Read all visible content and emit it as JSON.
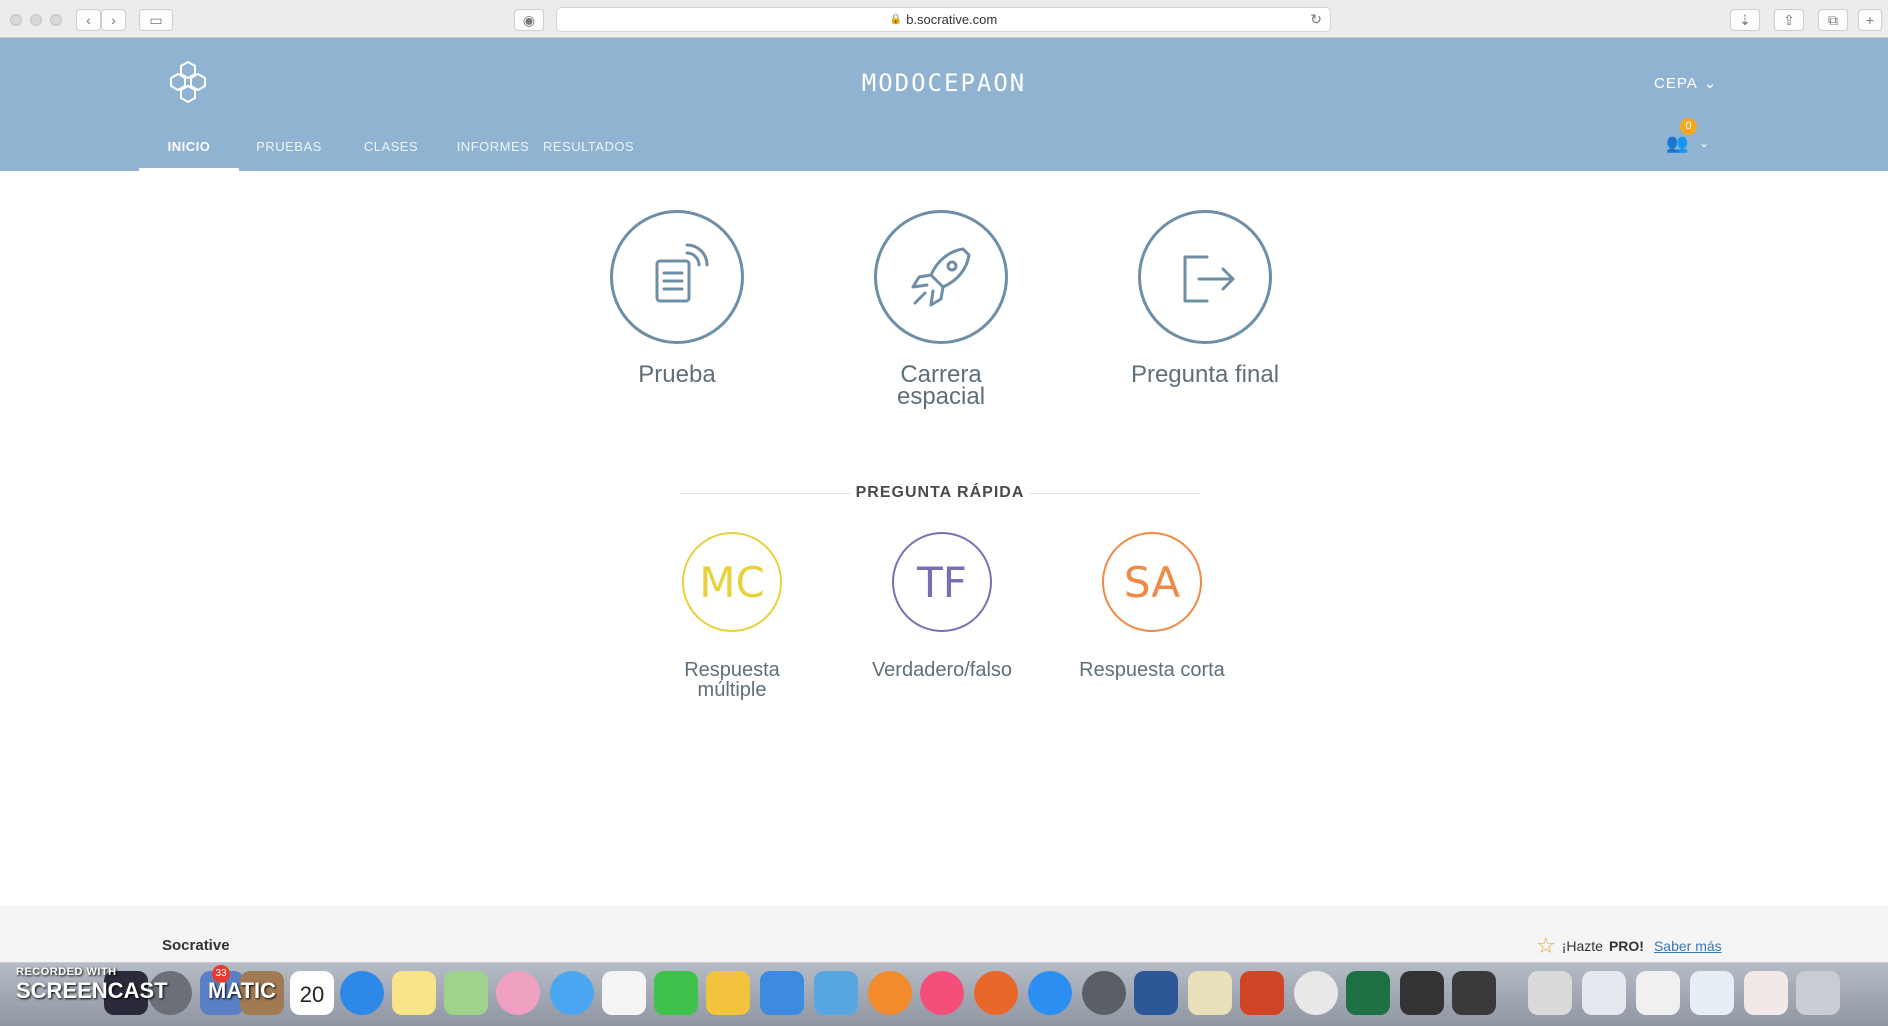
{
  "browser": {
    "url": "b.socrative.com"
  },
  "header": {
    "title": "MODOCEPAON",
    "user_label": "CEPA",
    "notification_count": "0",
    "nav": [
      "INICIO",
      "PRUEBAS",
      "CLASES",
      "INFORMES",
      "RESULTADOS"
    ],
    "active_nav": "INICIO"
  },
  "activities": [
    {
      "label_line1": "Prueba",
      "label_line2": ""
    },
    {
      "label_line1": "Carrera",
      "label_line2": "espacial"
    },
    {
      "label_line1": "Pregunta final",
      "label_line2": ""
    }
  ],
  "quick_question": {
    "title": "PREGUNTA RÁPIDA",
    "items": [
      {
        "abbr": "MC",
        "label_line1": "Respuesta",
        "label_line2": "múltiple",
        "color": "#e8d23c"
      },
      {
        "abbr": "TF",
        "label_line1": "Verdadero/falso",
        "label_line2": "",
        "color": "#7b6fb4"
      },
      {
        "abbr": "SA",
        "label_line1": "Respuesta corta",
        "label_line2": "",
        "color": "#ee8a45"
      }
    ]
  },
  "footer": {
    "brand": "Socrative",
    "pro_text": "¡Hazte",
    "pro_bold": "PRO!",
    "learn_more": "Saber más"
  },
  "dock": {
    "watermark_line1": "RECORDED WITH",
    "watermark_line2": "SCREENCAST",
    "watermark_line3": "MATIC",
    "calendar_day": "20",
    "badge_count": "33"
  },
  "colors": {
    "header_bg": "#8fb3d0",
    "circle_stroke": "#6e8ea6"
  }
}
